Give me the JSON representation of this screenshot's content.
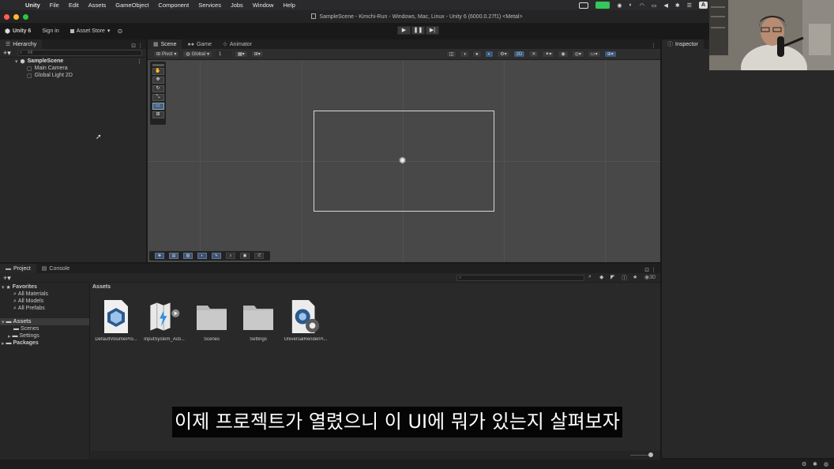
{
  "menubar": {
    "app": "Unity",
    "items": [
      "File",
      "Edit",
      "Assets",
      "GameObject",
      "Component",
      "Services",
      "Jobs",
      "Window",
      "Help"
    ],
    "tray_letter": "A"
  },
  "window": {
    "title": "SampleScene - Kimchi-Run - Windows, Mac, Linux - Unity 6 (6000.0.27f1) <Metal>"
  },
  "toolbar": {
    "account": "Unity 6",
    "sign_in": "Sign in",
    "asset_store": "Asset Store"
  },
  "hierarchy": {
    "tab": "Hierarchy",
    "search_placeholder": "All",
    "scene": "SampleScene",
    "objects": [
      "Main Camera",
      "Global Light 2D"
    ]
  },
  "scene": {
    "tabs": [
      "Scene",
      "Game",
      "Animator"
    ],
    "pivot": "Pivot",
    "global": "Global",
    "grid_snap": "1",
    "mode_2d": "2D"
  },
  "inspector": {
    "tab": "Inspector"
  },
  "project": {
    "tabs": [
      "Project",
      "Console"
    ],
    "breadcrumb": "Assets",
    "hidden_count": "30",
    "favorites": {
      "label": "Favorites",
      "items": [
        "All Materials",
        "All Models",
        "All Prefabs"
      ]
    },
    "assets_root": "Assets",
    "asset_children": [
      "Scenes",
      "Settings"
    ],
    "packages": "Packages",
    "assets": [
      {
        "label": "DefaultVolumePro...",
        "icon": "volume-profile-icon"
      },
      {
        "label": "InputSystem_Acti...",
        "icon": "input-actions-icon"
      },
      {
        "label": "Scenes",
        "icon": "folder-icon"
      },
      {
        "label": "Settings",
        "icon": "folder-icon"
      },
      {
        "label": "UniversalRenderPi...",
        "icon": "render-pipeline-asset-icon"
      }
    ]
  },
  "subtitle": "이제 프로젝트가 열렸으니 이 UI에 뭐가 있는지 살펴보자",
  "colors": {
    "scene_bg": "#484848",
    "panel_bg": "#282828",
    "accent_blue": "#3a5a80",
    "traffic_red": "#ff5f57",
    "traffic_yellow": "#febc2e",
    "traffic_green": "#28c840"
  }
}
